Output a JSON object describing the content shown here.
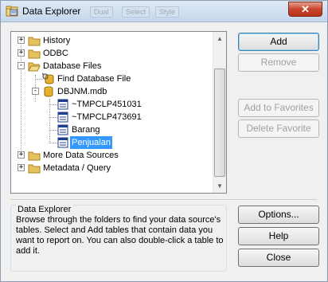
{
  "window": {
    "title": "Data Explorer",
    "close_label": "✕",
    "ghost_tabs": [
      "Dual",
      "Select",
      "Style"
    ]
  },
  "tree": {
    "items": [
      {
        "label": "History",
        "icon": "folder-icon",
        "expander": "+"
      },
      {
        "label": "ODBC",
        "icon": "folder-icon",
        "expander": "+"
      },
      {
        "label": "Database Files",
        "icon": "folder-open-icon",
        "expander": "-"
      },
      {
        "label": "Find Database File",
        "icon": "find-database-icon"
      },
      {
        "label": "DBJNM.mdb",
        "icon": "database-icon",
        "expander": "-"
      },
      {
        "label": "~TMPCLP451031",
        "icon": "table-icon"
      },
      {
        "label": "~TMPCLP473691",
        "icon": "table-icon"
      },
      {
        "label": "Barang",
        "icon": "table-icon"
      },
      {
        "label": "Penjualan",
        "icon": "table-icon",
        "selected": true
      },
      {
        "label": "More Data Sources",
        "icon": "folder-icon",
        "expander": "+"
      },
      {
        "label": "Metadata / Query",
        "icon": "folder-icon",
        "expander": "+"
      }
    ]
  },
  "buttons": {
    "add": "Add",
    "remove": "Remove",
    "add_favorites": "Add to Favorites",
    "delete_favorite": "Delete Favorite",
    "options": "Options...",
    "help": "Help",
    "close": "Close"
  },
  "info": {
    "title": "Data Explorer",
    "body": "Browse through the folders to find your data source's tables.  Select and Add tables that contain data you want to report on.  You can also double-click a table to add it."
  },
  "colors": {
    "selection": "#3399ff",
    "folder": "#e8c15a",
    "close_button": "#c8452d"
  }
}
